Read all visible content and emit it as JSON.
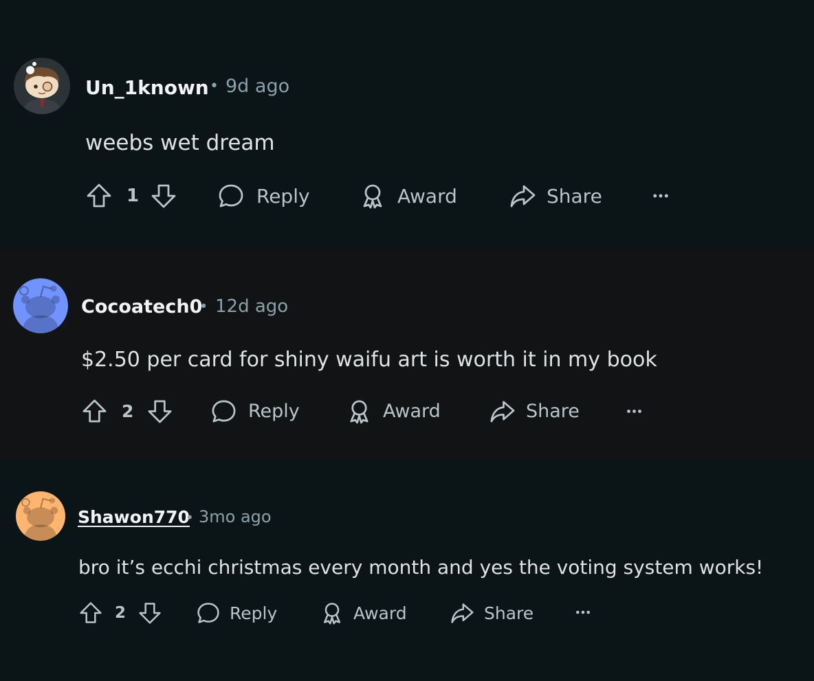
{
  "colors": {
    "background": "#0b1416",
    "text": "#d7dadc",
    "muted": "#8ba2ad"
  },
  "comments": [
    {
      "author": "Un_1known",
      "separator": "•",
      "time": "9d ago",
      "body": "weebs wet dream",
      "score": "1",
      "avatar_icon": "custom-snoo-avatar-icon",
      "actions": {
        "reply": "Reply",
        "award": "Award",
        "share": "Share"
      }
    },
    {
      "author": "Cocoatech0",
      "separator": "•",
      "time": "12d ago",
      "body": "$2.50 per card for shiny waifu art is worth it in my book",
      "score": "2",
      "avatar_icon": "default-snoo-avatar-icon",
      "avatar_color": "#7193ff",
      "actions": {
        "reply": "Reply",
        "award": "Award",
        "share": "Share"
      }
    },
    {
      "author": "Shawon770",
      "separator": "•",
      "time": "3mo ago",
      "body": "bro it’s ecchi christmas every month and yes the voting system works!",
      "score": "2",
      "avatar_icon": "default-snoo-avatar-icon",
      "avatar_color": "#ffb470",
      "actions": {
        "reply": "Reply",
        "award": "Award",
        "share": "Share"
      }
    }
  ]
}
